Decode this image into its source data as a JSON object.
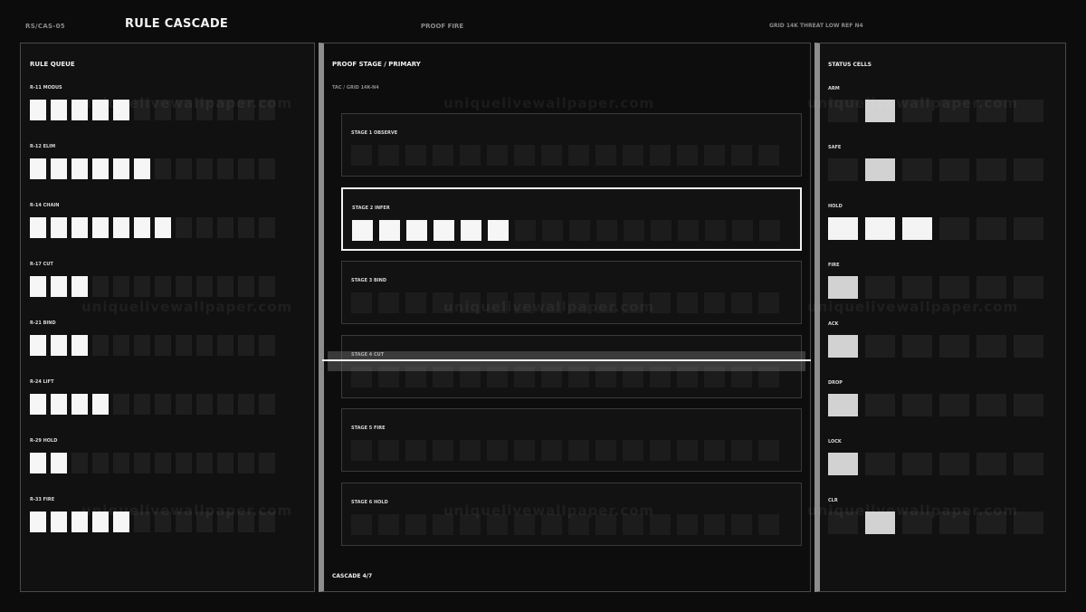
{
  "header": {
    "code": "RS/CAS-05",
    "title": "RULE CASCADE",
    "mode": "PROOF FIRE",
    "meta": "GRID 14K  THREAT LOW  REF N4"
  },
  "rule_queue": {
    "title": "RULE QUEUE",
    "rules": [
      {
        "label": "R-11 MODUS",
        "filled": 5,
        "total": 12
      },
      {
        "label": "R-12 ELIM",
        "filled": 6,
        "total": 12
      },
      {
        "label": "R-14 CHAIN",
        "filled": 7,
        "total": 12
      },
      {
        "label": "R-17 CUT",
        "filled": 3,
        "total": 12
      },
      {
        "label": "R-21 BIND",
        "filled": 3,
        "total": 12
      },
      {
        "label": "R-24 LIFT",
        "filled": 4,
        "total": 12
      },
      {
        "label": "R-29 HOLD",
        "filled": 2,
        "total": 12
      },
      {
        "label": "R-33 FIRE",
        "filled": 5,
        "total": 12
      }
    ]
  },
  "proof_stage": {
    "title": "PROOF STAGE  /  PRIMARY",
    "subtitle": "TAC  /  GRID 14K-N4",
    "stages": [
      {
        "label": "STAGE 1  OBSERVE",
        "filled": 0,
        "total": 16,
        "active": false
      },
      {
        "label": "STAGE 2  INFER",
        "filled": 6,
        "total": 16,
        "active": true
      },
      {
        "label": "STAGE 3  BIND",
        "filled": 0,
        "total": 16,
        "active": false
      },
      {
        "label": "STAGE 4  CUT",
        "filled": 0,
        "total": 16,
        "active": false
      },
      {
        "label": "STAGE 5  FIRE",
        "filled": 0,
        "total": 16,
        "active": false
      },
      {
        "label": "STAGE 6  HOLD",
        "filled": 0,
        "total": 16,
        "active": false
      }
    ],
    "footer": "CASCADE 4/7"
  },
  "status_cells": {
    "title": "STATUS CELLS",
    "rows": [
      {
        "label": "ARM",
        "cells": [
          "off",
          "lit",
          "off",
          "off",
          "off",
          "off"
        ]
      },
      {
        "label": "SAFE",
        "cells": [
          "off",
          "lit",
          "off",
          "off",
          "off",
          "off"
        ]
      },
      {
        "label": "HOLD",
        "cells": [
          "bright",
          "bright",
          "bright",
          "off",
          "off",
          "off"
        ]
      },
      {
        "label": "FIRE",
        "cells": [
          "lit",
          "off",
          "off",
          "off",
          "off",
          "off"
        ]
      },
      {
        "label": "ACK",
        "cells": [
          "lit",
          "off",
          "off",
          "off",
          "off",
          "off"
        ]
      },
      {
        "label": "DROP",
        "cells": [
          "lit",
          "off",
          "off",
          "off",
          "off",
          "off"
        ]
      },
      {
        "label": "LOCK",
        "cells": [
          "lit",
          "off",
          "off",
          "off",
          "off",
          "off"
        ]
      },
      {
        "label": "CLR",
        "cells": [
          "off",
          "lit",
          "off",
          "off",
          "off",
          "off"
        ]
      }
    ]
  },
  "watermark": "uniquelivewallpaper.com"
}
